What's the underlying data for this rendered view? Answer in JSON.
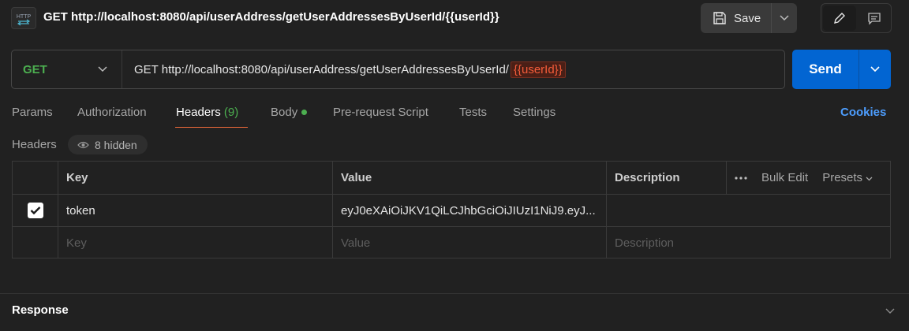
{
  "header": {
    "icon": "http-request-icon",
    "icon_text": "HTTP",
    "title": "GET http://localhost:8080/api/userAddress/getUserAddressesByUserId/{{userId}}",
    "save_label": "Save"
  },
  "request": {
    "method": "GET",
    "method_color": "#4caf50",
    "url_prefix": "GET http://localhost:8080/api/userAddress/getUserAddressesByUserId/",
    "url_variable": "{{userId}}",
    "send_label": "Send",
    "send_color": "#0265d2"
  },
  "tabs": [
    {
      "label": "Params"
    },
    {
      "label": "Authorization"
    },
    {
      "label": "Headers",
      "count": "(9)",
      "active": true
    },
    {
      "label": "Body",
      "dot": true
    },
    {
      "label": "Pre-request Script"
    },
    {
      "label": "Tests"
    },
    {
      "label": "Settings"
    }
  ],
  "cookies_label": "Cookies",
  "headers_section": {
    "label": "Headers",
    "hidden_label": "8 hidden"
  },
  "table": {
    "columns": {
      "key": "Key",
      "value": "Value",
      "description": "Description"
    },
    "bulk_edit": "Bulk Edit",
    "presets": "Presets",
    "rows": [
      {
        "checked": true,
        "key": "token",
        "value": "eyJ0eXAiOiJKV1QiLCJhbGciOiJIUzI1NiJ9.eyJ...",
        "description": ""
      }
    ],
    "placeholders": {
      "key": "Key",
      "value": "Value",
      "description": "Description"
    }
  },
  "response_label": "Response"
}
